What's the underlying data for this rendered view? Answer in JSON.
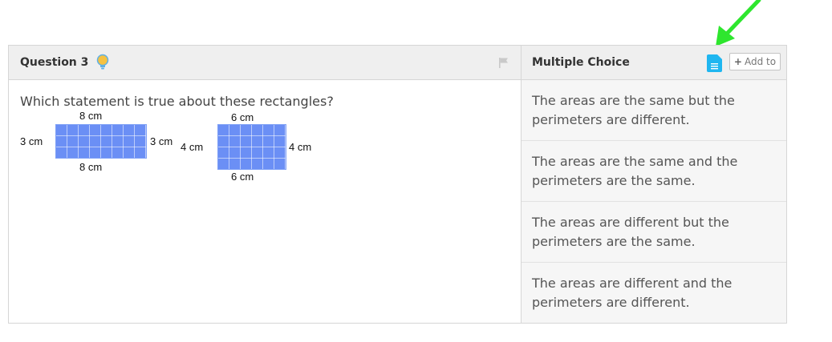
{
  "question": {
    "title": "Question 3",
    "prompt": "Which statement is true about these rectangles?",
    "figure": {
      "rect1": {
        "top_label": "8 cm",
        "bottom_label": "8 cm",
        "left_label": "3 cm",
        "right_label": "3 cm"
      },
      "rect2": {
        "top_label": "6 cm",
        "bottom_label": "6 cm",
        "left_label": "4 cm",
        "right_label": "4 cm"
      }
    }
  },
  "answers": {
    "title": "Multiple Choice",
    "add_label": "Add to",
    "choices": [
      {
        "line1": "The areas are the same but the",
        "line2": "perimeters are different."
      },
      {
        "line1": "The areas are the same and the",
        "line2": "perimeters are the same."
      },
      {
        "line1": "The areas are different but the",
        "line2": "perimeters are the same."
      },
      {
        "line1": "The areas are different and the",
        "line2": "perimeters are different."
      }
    ]
  },
  "colors": {
    "arrow": "#2ee62e",
    "doc_icon": "#1fb6f0",
    "rect_fill": "#6b8ff5",
    "bulb": "#f5c242"
  }
}
